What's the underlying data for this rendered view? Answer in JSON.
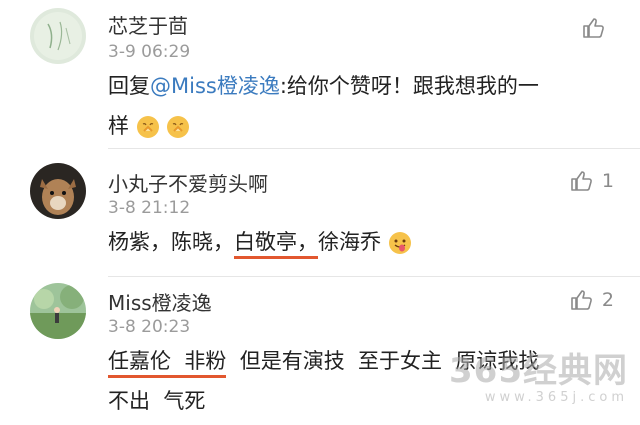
{
  "comments": [
    {
      "username": "芯芝于茴",
      "time": "3-9 06:29",
      "reply_prefix": "回复",
      "mention": "@Miss橙凌逸",
      "text_line1": ":给你个赞呀！跟我想我的一",
      "text_line2": "样",
      "like_count": ""
    },
    {
      "username": "小丸子不爱剪头啊",
      "time": "3-8 21:12",
      "text_a": "杨紫，陈晓，",
      "text_underlined": "白敬亭，",
      "text_b": "徐海乔",
      "like_count": "1"
    },
    {
      "username": "Miss橙凌逸",
      "time": "3-8 20:23",
      "text_underlined": "任嘉伦  非粉",
      "text_a": "  但是有演技  至于女主  原谅我找",
      "text_line2": "不出  气死",
      "like_count": "2"
    }
  ],
  "icons": [
    "thumbs-up-icon",
    "emoji-clap-icon",
    "emoji-tongue-icon"
  ],
  "watermark": {
    "main": "365经典网",
    "sub": "www.365j.com"
  },
  "colors": {
    "mention": "#3b7bbf",
    "underline": "#e2572f",
    "time": "#9b9b9b"
  }
}
